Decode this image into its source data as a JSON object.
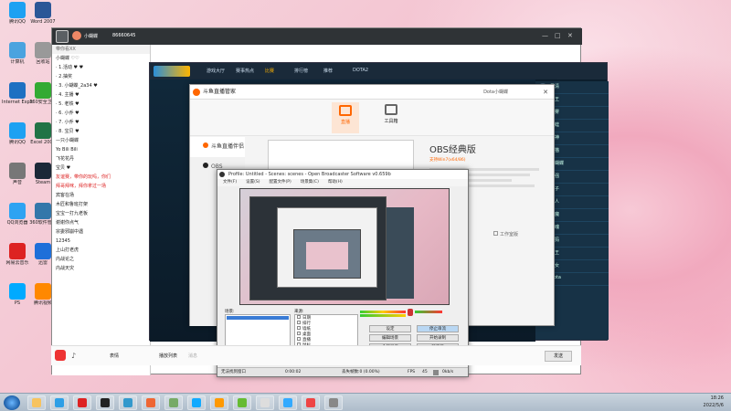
{
  "desktop_icons": [
    {
      "label": "腾讯QQ"
    },
    {
      "label": "Word 2007"
    },
    {
      "label": "计算机"
    },
    {
      "label": "回收站"
    },
    {
      "label": "Internet Explorer"
    },
    {
      "label": "360安全卫士"
    },
    {
      "label": "腾讯QQ"
    },
    {
      "label": "Excel 2007"
    },
    {
      "label": "声音"
    },
    {
      "label": "Steam"
    },
    {
      "label": "QQ浏览器"
    },
    {
      "label": "360软件管家"
    },
    {
      "label": "网易云音乐"
    },
    {
      "label": "迅雷"
    },
    {
      "label": "PS"
    },
    {
      "label": "腾讯视频"
    }
  ],
  "yy": {
    "nickname": "小蝴蝶",
    "room_id": "86660645",
    "chat_header": "带你看XX",
    "chat_lines": [
      "小蝴蝶 ♡♡",
      "· 1.活动 ♥ ♥",
      "· 2.抽奖",
      "· 3. 小蝴蝶_2a34 ♥",
      "· 4. 主播 ♥",
      "· 5. 老铁 ♥",
      "· 6. 小乔 ♥",
      "· 7. 小乔 ♥",
      "· 8. 宝贝 ♥",
      "—只小蝴蝶",
      "Yo Bili Bili",
      "飞花花丹",
      "宝贝 ♥",
      "友谊赛，带你的玩吗，你们",
      "拜哥拜咪，拜你拿过一场",
      "宾客在场",
      "木匠和鲁班打架",
      "宝宝一打九老板",
      "谢谢你点气",
      "宗委邪崩中遇",
      "12345",
      "上山打老虎",
      "内战论之",
      "内战天灾"
    ],
    "chat_input_placeholder": "消息",
    "bottom_bar": [
      "表情",
      "播放列表",
      "发送"
    ]
  },
  "game": {
    "tabs": [
      "游戏大厅",
      "赛事热点",
      "比赛",
      "排行榜",
      "推荐",
      "DOTA2"
    ],
    "right_list": [
      "风清",
      "天王",
      "大雾",
      "冰蛙",
      "战神",
      "黑猫",
      "小蝴蝶",
      "小强",
      "舟子",
      "路人",
      "影魔",
      "电魂",
      "猛犸",
      "沙王",
      "火女",
      "Dota"
    ]
  },
  "douyu": {
    "title": "斗鱼直播管家",
    "user_label": "Dota小蝴蝶",
    "tabs": [
      {
        "label": "直播"
      },
      {
        "label": "工具箱"
      }
    ],
    "side_items": [
      "斗鱼直播伴侣",
      "OBS"
    ],
    "obs_title": "OBS经典版",
    "obs_link": "支持Win7(x64/86)",
    "checkbox_label": "工作室版"
  },
  "obs": {
    "title": "Profile: Untitled - Scenes: scenes - Open Broadcaster Software v0.659b",
    "menu": [
      "文件(F)",
      "设置(S)",
      "配置文件(P)",
      "场景集(C)",
      "帮助(H)"
    ],
    "scenes_label": "场景:",
    "sources_label": "来源:",
    "sources": [
      "日期",
      "排行",
      "墙纸",
      "桌面",
      "直播",
      "鼠标",
      "大神聚",
      "窗口"
    ],
    "buttons": [
      "设定",
      "停止串流",
      "编辑场景",
      "开始录制",
      "全频显示",
      "预览流",
      "插件",
      "退出"
    ],
    "status": {
      "msg": "无法找到窗口",
      "time": "0:00:02",
      "fps_label": "FPS",
      "fps": "45",
      "dropped": "丢失帧数:0 (0.00%)",
      "kbps": "0kb/s"
    }
  },
  "taskbar": {
    "time": "18:26",
    "date": "2022/5/6"
  },
  "colors": {
    "accent": "#f60",
    "obs_stop": "#b9d7f3",
    "game_bg": "#0c1e2c"
  }
}
